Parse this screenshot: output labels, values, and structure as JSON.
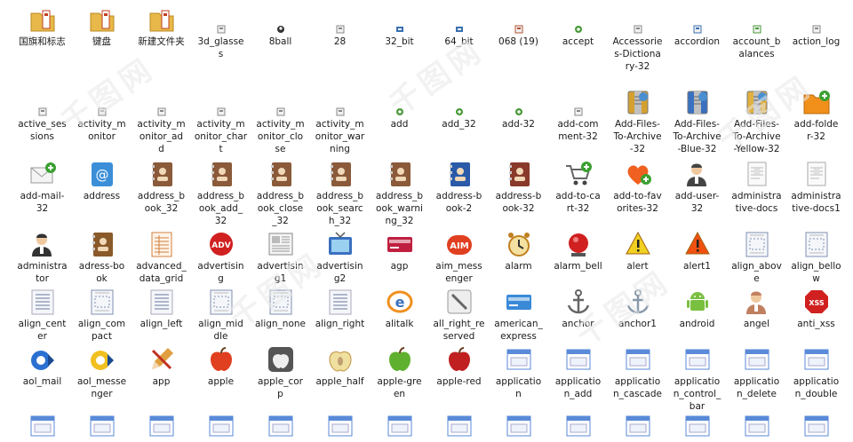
{
  "rows": [
    [
      {
        "label": "国旗和标志",
        "icon": "folder-icon",
        "color": "#e8b84a"
      },
      {
        "label": "键盘",
        "icon": "folder-icon",
        "color": "#e8b84a"
      },
      {
        "label": "新建文件夹",
        "icon": "folder-icon",
        "color": "#e8b84a"
      },
      {
        "label": "3d_glasse\ns",
        "icon": "small-file-icon",
        "color": "#888888"
      },
      {
        "label": "8ball",
        "icon": "ball-icon",
        "color": "#333333"
      },
      {
        "label": "28",
        "icon": "small-file-icon",
        "color": "#888888"
      },
      {
        "label": "32_bit",
        "icon": "chip-icon",
        "color": "#3a6fb0"
      },
      {
        "label": "64_bit",
        "icon": "chip-icon",
        "color": "#3a6fb0"
      },
      {
        "label": "068 (19)",
        "icon": "small-file-icon",
        "color": "#b05030"
      },
      {
        "label": "accept",
        "icon": "check-icon",
        "color": "#4a9a3a"
      },
      {
        "label": "Accessorie\ns-Dictiona\nry-32",
        "icon": "small-file-icon",
        "color": "#888888"
      },
      {
        "label": "accordion",
        "icon": "small-file-icon",
        "color": "#3a6fb0"
      },
      {
        "label": "account_b\nalances",
        "icon": "small-file-icon",
        "color": "#4a9a3a"
      },
      {
        "label": "action_log",
        "icon": "small-file-icon",
        "color": "#888888"
      }
    ],
    [
      {
        "label": "active_ses\nsions",
        "icon": "small-file-icon",
        "color": "#888888"
      },
      {
        "label": "activity_m\nonitor",
        "icon": "small-file-icon",
        "color": "#888888"
      },
      {
        "label": "activity_m\nonitor_ad\nd",
        "icon": "small-file-icon",
        "color": "#888888"
      },
      {
        "label": "activity_m\nonitor_char\nt",
        "icon": "small-file-icon",
        "color": "#888888"
      },
      {
        "label": "activity_m\nonitor_clo\nse",
        "icon": "small-file-icon",
        "color": "#888888"
      },
      {
        "label": "activity_m\nonitor_war\nning",
        "icon": "small-file-icon",
        "color": "#888888"
      },
      {
        "label": "add",
        "icon": "plus-icon",
        "color": "#4a9a3a"
      },
      {
        "label": "add_32",
        "icon": "plus-icon",
        "color": "#4a9a3a"
      },
      {
        "label": "add-32",
        "icon": "plus-icon",
        "color": "#4a9a3a"
      },
      {
        "label": "add-com\nment-32",
        "icon": "small-file-icon",
        "color": "#888888"
      },
      {
        "label": "Add-Files-\nTo-Archive\n-32",
        "icon": "archive-icon",
        "color": "#d4a030"
      },
      {
        "label": "Add-Files-\nTo-Archive\n-Blue-32",
        "icon": "archive-icon",
        "color": "#3a70c0"
      },
      {
        "label": "Add-Files-\nTo-Archive\n-Yellow-32",
        "icon": "archive-icon",
        "color": "#e0b040"
      },
      {
        "label": "add-folde\nr-32",
        "icon": "folder-add-icon",
        "color": "#f0901a"
      }
    ],
    [
      {
        "label": "add-mail-\n32",
        "icon": "mail-icon",
        "color": "#dddddd"
      },
      {
        "label": "address",
        "icon": "at-icon",
        "color": "#3a8fd8"
      },
      {
        "label": "address_b\nook_32",
        "icon": "address-book-icon",
        "color": "#8a5a3a"
      },
      {
        "label": "address_b\nook_add_\n32",
        "icon": "address-book-icon",
        "color": "#8a5a3a"
      },
      {
        "label": "address_b\nook_close\n_32",
        "icon": "address-book-icon",
        "color": "#8a5a3a"
      },
      {
        "label": "address_b\nook_searc\nh_32",
        "icon": "address-book-icon",
        "color": "#8a5a3a"
      },
      {
        "label": "address_b\nook_warni\nng_32",
        "icon": "address-book-icon",
        "color": "#8a5a3a"
      },
      {
        "label": "address-b\nook-2",
        "icon": "address-book-icon",
        "color": "#2a5aa8"
      },
      {
        "label": "address-b\nook-32",
        "icon": "address-book-icon",
        "color": "#8a3a2a"
      },
      {
        "label": "add-to-ca\nrt-32",
        "icon": "cart-icon",
        "color": "#888888"
      },
      {
        "label": "add-to-fav\norites-32",
        "icon": "heart-icon",
        "color": "#f06020"
      },
      {
        "label": "add-user-\n32",
        "icon": "user-icon",
        "color": "#444444"
      },
      {
        "label": "administra\ntive-docs",
        "icon": "document-icon",
        "color": "#cccccc"
      },
      {
        "label": "administra\ntive-docs1",
        "icon": "document-icon",
        "color": "#cccccc"
      }
    ],
    [
      {
        "label": "administra\ntor",
        "icon": "user-icon",
        "color": "#333333"
      },
      {
        "label": "adress-bo\nok",
        "icon": "address-book-icon",
        "color": "#8a5a2a"
      },
      {
        "label": "advanced_\ndata_grid",
        "icon": "grid-doc-icon",
        "color": "#d08040"
      },
      {
        "label": "advertisin\ng",
        "icon": "badge-icon",
        "color": "#d02020"
      },
      {
        "label": "advertisin\ng1",
        "icon": "newspaper-icon",
        "color": "#999999"
      },
      {
        "label": "advertisin\ng2",
        "icon": "tv-icon",
        "color": "#3a70c0"
      },
      {
        "label": "agp",
        "icon": "card-icon",
        "color": "#c02040"
      },
      {
        "label": "aim_mess\nenger",
        "icon": "aim-icon",
        "color": "#e04020"
      },
      {
        "label": "alarm",
        "icon": "alarm-icon",
        "color": "#e0a030"
      },
      {
        "label": "alarm_bell",
        "icon": "bell-icon",
        "color": "#d02020"
      },
      {
        "label": "alert",
        "icon": "warning-icon",
        "color": "#f0d020"
      },
      {
        "label": "alert1",
        "icon": "warning-icon",
        "color": "#f05010"
      },
      {
        "label": "align_abov\ne",
        "icon": "frame-icon",
        "color": "#8090b0"
      },
      {
        "label": "align_bello\nw",
        "icon": "frame-icon",
        "color": "#8090b0"
      }
    ],
    [
      {
        "label": "align_cent\ner",
        "icon": "text-icon",
        "color": "#667799"
      },
      {
        "label": "align_com\npact",
        "icon": "frame-icon",
        "color": "#8090b0"
      },
      {
        "label": "align_left",
        "icon": "text-icon",
        "color": "#667799"
      },
      {
        "label": "align_mid\ndle",
        "icon": "frame-icon",
        "color": "#8090b0"
      },
      {
        "label": "align_none",
        "icon": "frame-icon",
        "color": "#8090b0"
      },
      {
        "label": "align_right",
        "icon": "text-icon",
        "color": "#667799"
      },
      {
        "label": "alitalk",
        "icon": "alitalk-icon",
        "color": "#f09020"
      },
      {
        "label": "all_right_re\nserved",
        "icon": "slash-icon",
        "color": "#666666"
      },
      {
        "label": "american_\nexpress",
        "icon": "card-icon",
        "color": "#3a8ad8"
      },
      {
        "label": "anchor",
        "icon": "anchor-icon",
        "color": "#666666"
      },
      {
        "label": "anchor1",
        "icon": "anchor-icon",
        "color": "#8899aa"
      },
      {
        "label": "android",
        "icon": "android-icon",
        "color": "#7ac040"
      },
      {
        "label": "angel",
        "icon": "user-icon",
        "color": "#c08060"
      },
      {
        "label": "anti_xss",
        "icon": "stop-icon",
        "color": "#d02020"
      }
    ],
    [
      {
        "label": "aol_mail",
        "icon": "aol-icon",
        "color": "#2a70d0"
      },
      {
        "label": "aol_messe\nnger",
        "icon": "aol-icon",
        "color": "#f0c020"
      },
      {
        "label": "app",
        "icon": "pencil-icon",
        "color": "#e0a040"
      },
      {
        "label": "apple",
        "icon": "apple-icon",
        "color": "#e04020"
      },
      {
        "label": "apple_cor\np",
        "icon": "apple-logo-icon",
        "color": "#777777"
      },
      {
        "label": "apple_half",
        "icon": "apple-half-icon",
        "color": "#f0e0a0"
      },
      {
        "label": "apple-gre\nen",
        "icon": "apple-icon",
        "color": "#60b030"
      },
      {
        "label": "apple-red",
        "icon": "apple-icon",
        "color": "#c02020"
      },
      {
        "label": "applicatio\nn",
        "icon": "window-icon",
        "color": "#5a8ad8"
      },
      {
        "label": "applicatio\nn_add",
        "icon": "window-icon",
        "color": "#5a8ad8"
      },
      {
        "label": "applicatio\nn_cascade",
        "icon": "window-icon",
        "color": "#5a8ad8"
      },
      {
        "label": "applicatio\nn_control_\nbar",
        "icon": "window-icon",
        "color": "#5a8ad8"
      },
      {
        "label": "applicatio\nn_delete",
        "icon": "window-icon",
        "color": "#5a8ad8"
      },
      {
        "label": "applicatio\nn_double",
        "icon": "window-icon",
        "color": "#5a8ad8"
      }
    ],
    [
      {
        "label": "",
        "icon": "window-icon",
        "color": "#5a8ad8"
      },
      {
        "label": "",
        "icon": "window-icon",
        "color": "#5a8ad8"
      },
      {
        "label": "",
        "icon": "window-icon",
        "color": "#5a8ad8"
      },
      {
        "label": "",
        "icon": "window-icon",
        "color": "#5a8ad8"
      },
      {
        "label": "",
        "icon": "window-icon",
        "color": "#5a8ad8"
      },
      {
        "label": "",
        "icon": "window-icon",
        "color": "#5a8ad8"
      },
      {
        "label": "",
        "icon": "window-icon",
        "color": "#5a8ad8"
      },
      {
        "label": "",
        "icon": "window-icon",
        "color": "#5a8ad8"
      },
      {
        "label": "",
        "icon": "window-icon",
        "color": "#5a8ad8"
      },
      {
        "label": "",
        "icon": "window-icon",
        "color": "#5a8ad8"
      },
      {
        "label": "",
        "icon": "window-icon",
        "color": "#5a8ad8"
      },
      {
        "label": "",
        "icon": "window-icon",
        "color": "#5a8ad8"
      },
      {
        "label": "",
        "icon": "window-icon",
        "color": "#5a8ad8"
      },
      {
        "label": "",
        "icon": "window-icon",
        "color": "#5a8ad8"
      }
    ]
  ],
  "watermark": "千图网"
}
